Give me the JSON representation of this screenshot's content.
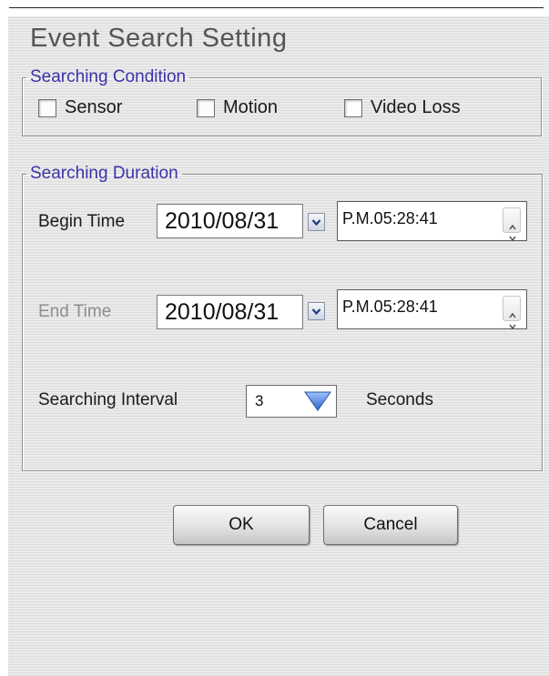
{
  "dialog": {
    "title": "Event Search Setting"
  },
  "searching_condition": {
    "legend": "Searching Condition",
    "options": [
      {
        "label": "Sensor",
        "checked": false
      },
      {
        "label": "Motion",
        "checked": false
      },
      {
        "label": "Video Loss",
        "checked": false
      }
    ]
  },
  "searching_duration": {
    "legend": "Searching Duration",
    "begin": {
      "label": "Begin Time",
      "date": "2010/08/31",
      "time": "P.M.05:28:41",
      "enabled": true
    },
    "end": {
      "label": "End Time",
      "date": "2010/08/31",
      "time": "P.M.05:28:41",
      "enabled": false
    },
    "interval": {
      "label": "Searching Interval",
      "value": "3",
      "unit": "Seconds"
    }
  },
  "buttons": {
    "ok": "OK",
    "cancel": "Cancel"
  },
  "colors": {
    "legend_text": "#3b32a8",
    "dropdown_arrow": "#3a6fd0",
    "disabled_text": "#8e8e8e"
  }
}
